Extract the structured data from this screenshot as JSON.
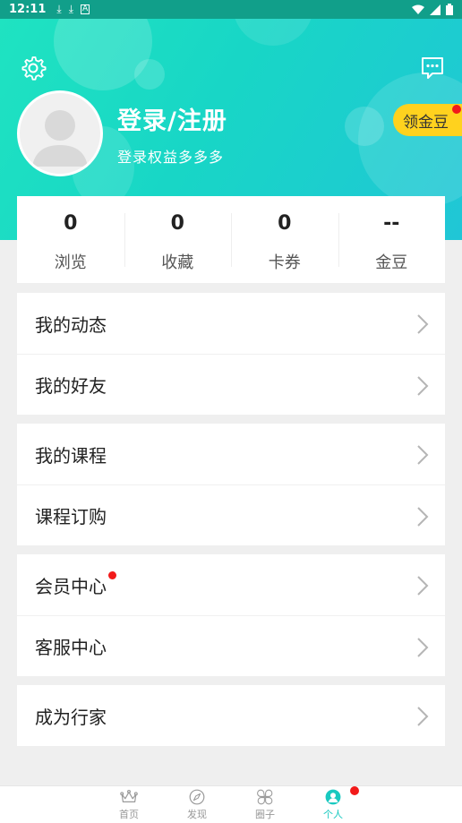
{
  "status_bar": {
    "time": "12:11",
    "icons": [
      "download-icon",
      "download-icon",
      "a-icon"
    ],
    "right_icons": [
      "wifi-icon",
      "signal-icon",
      "battery-icon"
    ]
  },
  "header": {
    "settings_icon": "gear-icon",
    "message_icon": "chat-bubble-icon",
    "login_title": "登录/注册",
    "login_subtitle": "登录权益多多多",
    "gold_button": "领金豆"
  },
  "stats": [
    {
      "value": "0",
      "label": "浏览"
    },
    {
      "value": "0",
      "label": "收藏"
    },
    {
      "value": "0",
      "label": "卡券"
    },
    {
      "value": "--",
      "label": "金豆"
    }
  ],
  "menu_groups": [
    {
      "items": [
        {
          "label": "我的动态"
        },
        {
          "label": "我的好友"
        }
      ]
    },
    {
      "items": [
        {
          "label": "我的课程"
        },
        {
          "label": "课程订购"
        }
      ]
    },
    {
      "items": [
        {
          "label": "会员中心",
          "badge": true
        },
        {
          "label": "客服中心"
        }
      ]
    },
    {
      "items": [
        {
          "label": "成为行家"
        }
      ]
    }
  ],
  "tabbar": {
    "tabs": [
      {
        "icon": "crown-icon",
        "label": "首页"
      },
      {
        "icon": "compass-icon",
        "label": "发现"
      },
      {
        "icon": "clover-icon",
        "label": "圈子"
      },
      {
        "icon": "profile-icon",
        "label": "个人",
        "active": true,
        "badge": true
      }
    ]
  },
  "colors": {
    "primary": "#1fd6c6",
    "accent_yellow": "#ffd21e",
    "badge_red": "#f21a1a"
  }
}
